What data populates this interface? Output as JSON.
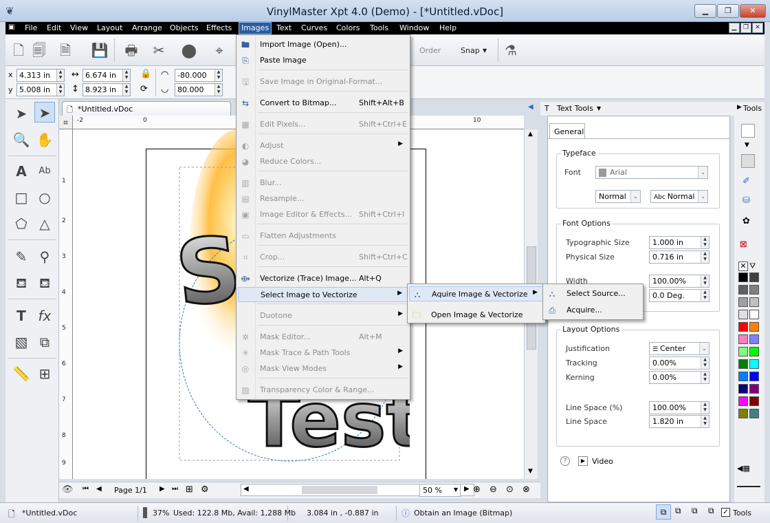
{
  "window": {
    "title": "VinylMaster Xpt 4.0 (Demo) - [*Untitled.vDoc]",
    "min": "▁",
    "max": "❐",
    "close": "✕"
  },
  "menubar": [
    "File",
    "Edit",
    "View",
    "Layout",
    "Arrange",
    "Objects",
    "Effects",
    "Images",
    "Text",
    "Curves",
    "Colors",
    "Tools",
    "Window",
    "Help"
  ],
  "toolbar": {
    "order": "Order",
    "snap": "Snap"
  },
  "coords": {
    "x_label": "x",
    "y_label": "y",
    "x": "4.313 in",
    "y": "5.008 in",
    "width": "6.674 in",
    "height": "8.923 in",
    "angle": "-80.000",
    "scale": "80.000"
  },
  "document": {
    "tab": "*Untitled.vDoc",
    "page": "Page 1/1",
    "zoom": "50 %",
    "ruler_h": [
      "-2",
      "0",
      "10"
    ],
    "ruler_v": [
      "1",
      "2",
      "3",
      "4",
      "5",
      "6",
      "7",
      "8",
      "9"
    ]
  },
  "images_menu": [
    {
      "label": "Import Image (Open)...",
      "shortcut": "",
      "enabled": true,
      "icon": "import-image-icon"
    },
    {
      "label": "Paste Image",
      "shortcut": "",
      "enabled": true,
      "icon": "paste-image-icon"
    },
    {
      "label": "Save Image in Original-Format...",
      "shortcut": "",
      "enabled": false,
      "icon": "save-image-icon"
    },
    {
      "label": "Convert to Bitmap...",
      "shortcut": "Shift+Alt+B",
      "enabled": true,
      "icon": "convert-bitmap-icon"
    },
    {
      "label": "Edit Pixels...",
      "shortcut": "Shift+Ctrl+E",
      "enabled": false,
      "icon": "edit-pixels-icon"
    },
    {
      "label": "Adjust",
      "shortcut": "",
      "enabled": false,
      "icon": "adjust-icon",
      "submenu": true
    },
    {
      "label": "Reduce Colors...",
      "shortcut": "",
      "enabled": false,
      "icon": "reduce-colors-icon"
    },
    {
      "label": "Blur...",
      "shortcut": "",
      "enabled": false,
      "icon": "blur-icon"
    },
    {
      "label": "Resample...",
      "shortcut": "",
      "enabled": false,
      "icon": "resample-icon"
    },
    {
      "label": "Image Editor & Effects...",
      "shortcut": "Shift+Ctrl+I",
      "enabled": false,
      "icon": "image-editor-icon"
    },
    {
      "label": "Flatten Adjustments",
      "shortcut": "",
      "enabled": false,
      "icon": "flatten-icon"
    },
    {
      "label": "Crop...",
      "shortcut": "Shift+Ctrl+C",
      "enabled": false,
      "icon": "crop-icon"
    },
    {
      "label": "Vectorize (Trace) Image...",
      "shortcut": "Alt+Q",
      "enabled": true,
      "icon": "vectorize-icon"
    },
    {
      "label": "Select Image to Vectorize",
      "shortcut": "",
      "enabled": true,
      "icon": "",
      "submenu": true
    },
    {
      "label": "Duotone",
      "shortcut": "",
      "enabled": false,
      "icon": "",
      "submenu": true
    },
    {
      "label": "Mask Editor...",
      "shortcut": "Alt+M",
      "enabled": false,
      "icon": "mask-editor-icon"
    },
    {
      "label": "Mask Trace & Path Tools",
      "shortcut": "",
      "enabled": false,
      "icon": "mask-trace-icon",
      "submenu": true
    },
    {
      "label": "Mask View Modes",
      "shortcut": "",
      "enabled": false,
      "icon": "mask-view-icon",
      "submenu": true
    },
    {
      "label": "Transparency Color & Range...",
      "shortcut": "",
      "enabled": false,
      "icon": "transparency-icon"
    }
  ],
  "submenu1": [
    "Aquire Image & Vectorize",
    "Open Image & Vectorize"
  ],
  "submenu2": [
    "Select Source...",
    "Acquire..."
  ],
  "panel": {
    "title": "Text Tools",
    "tools": "Tools",
    "tab": "General",
    "typeface": {
      "title": "Typeface",
      "font_label": "Font",
      "font": "Arial",
      "style": "Normal",
      "case": "Normal"
    },
    "font_options": {
      "title": "Font Options",
      "typographic_size_label": "Typographic Size",
      "typographic_size": "1.000 in",
      "physical_size_label": "Physical Size",
      "physical_size": "0.716 in",
      "width_label": "Width",
      "width": "100.00%",
      "slant_value": "0.0 Deg."
    },
    "layout_options": {
      "title": "Layout Options",
      "justification_label": "Justification",
      "justification": "Center",
      "tracking_label": "Tracking",
      "tracking": "0.00%",
      "kerning_label": "Kerning",
      "kerning": "0.00%",
      "line_space_pct_label": "Line Space (%)",
      "line_space_pct": "100.00%",
      "line_space_label": "Line Space",
      "line_space": "1.820 in"
    },
    "video": "Video"
  },
  "palette": [
    "#000000",
    "#404040",
    "#606060",
    "#808080",
    "#a0a0a0",
    "#c0c0c0",
    "#e0e0e0",
    "#ffffff",
    "#ff0000",
    "#ff8000",
    "#ff80c0",
    "#8080ff",
    "#80ff80",
    "#00ff00",
    "#008000",
    "#00ffff",
    "#0080ff",
    "#0000ff",
    "#000080",
    "#800080",
    "#ff00ff",
    "#800000",
    "#808000",
    "#408080"
  ],
  "status": {
    "doc": "*Untitled.vDoc",
    "usage_pct": "37%",
    "memory": "Used: 122.8 Mb, Avail: 1,288 Mb",
    "cursor": "3.084 in , -0.887 in",
    "hint": "Obtain an Image (Bitmap)",
    "tools": "Tools"
  }
}
